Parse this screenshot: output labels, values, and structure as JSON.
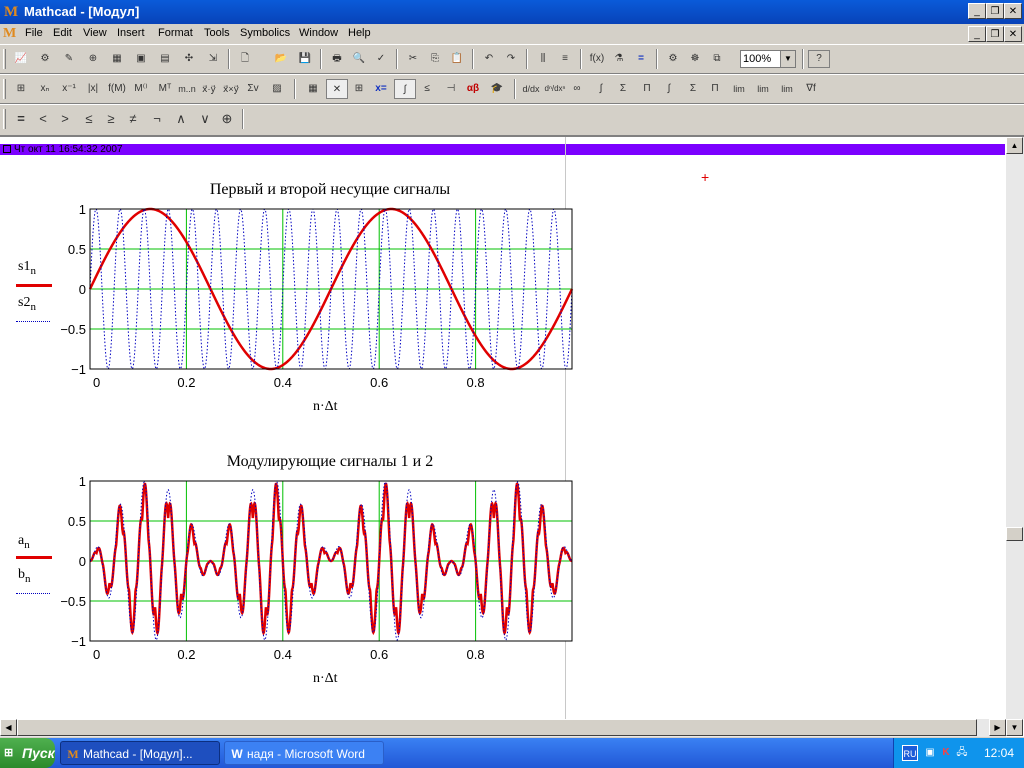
{
  "window": {
    "title": "Mathcad - [Модул]"
  },
  "menubar": {
    "items": [
      "File",
      "Edit",
      "View",
      "Insert",
      "Format",
      "Tools",
      "Symbolics",
      "Window",
      "Help"
    ]
  },
  "toolbar": {
    "zoom": "100%"
  },
  "math_toolbar": {
    "items": [
      "xₙ",
      "x⁻¹",
      "|x|",
      "f(M)",
      "M⁽⁾",
      "Mᵀ",
      "m..n",
      "x⃗·y⃗",
      "x⃗×y⃗",
      "Σv"
    ]
  },
  "boolean_toolbar": {
    "items": [
      "=",
      "<",
      ">",
      "≤",
      "≥",
      "≠",
      "¬",
      "∧",
      "∨",
      "⊕"
    ]
  },
  "calculus_toolbar": {
    "items": [
      "d/dx",
      "dⁿ/dxⁿ",
      "∞",
      "∫",
      "Σ",
      "Π",
      "∫",
      "Σ",
      "Π",
      "lim",
      "lim",
      "lim",
      "∇f"
    ]
  },
  "region_header": {
    "text": "Чт окт 11 16:54:32 2007"
  },
  "charts": [
    {
      "title": "Первый и второй несущие сигналы",
      "xlabel": "n·Δt",
      "legend": [
        {
          "base": "s1",
          "sub": "n"
        },
        {
          "base": "s2",
          "sub": "n"
        }
      ],
      "yticks": [
        "1",
        "0.5",
        "0",
        "−0.5",
        "−1"
      ],
      "xticks": [
        "0",
        "0.2",
        "0.4",
        "0.6",
        "0.8"
      ]
    },
    {
      "title": "Модулирующие сигналы 1 и 2",
      "xlabel": "n·Δt",
      "legend": [
        {
          "base": "a",
          "sub": "n"
        },
        {
          "base": "b",
          "sub": "n"
        }
      ],
      "yticks": [
        "1",
        "0.5",
        "0",
        "−0.5",
        "−1"
      ],
      "xticks": [
        "0",
        "0.2",
        "0.4",
        "0.6",
        "0.8"
      ]
    }
  ],
  "chart_data": [
    {
      "type": "line",
      "title": "Первый и второй несущие сигналы",
      "xlabel": "n·Δt",
      "xlim": [
        0,
        1
      ],
      "ylim": [
        -1,
        1
      ],
      "grid": true,
      "legend": "left",
      "series": [
        {
          "name": "s1n",
          "style": "solid",
          "color": "#e00000",
          "function": "sin(2π·2·t)"
        },
        {
          "name": "s2n",
          "style": "dotted",
          "color": "#0000c0",
          "function": "sin(2π·20·t)"
        }
      ]
    },
    {
      "type": "line",
      "title": "Модулирующие сигналы 1 и 2",
      "xlabel": "n·Δt",
      "xlim": [
        0,
        1
      ],
      "ylim": [
        -1,
        1
      ],
      "grid": true,
      "legend": "left",
      "series": [
        {
          "name": "an",
          "style": "solid",
          "color": "#e00000",
          "function": "sin(2π·2·t)·sin(2π·20·t)"
        },
        {
          "name": "bn",
          "style": "dotted",
          "color": "#0000c0",
          "function": "sin(2π·2·t)·sin(2π·20·t)"
        }
      ]
    }
  ],
  "taskbar": {
    "start": "Пуск",
    "tasks": [
      "Mathcad - [Модул]...",
      "надя - Microsoft Word"
    ],
    "tray": {
      "lang": "RU",
      "clock": "12:04"
    }
  },
  "colors": {
    "header_bar": "#7b00ff",
    "grid": "#00c000",
    "series1": "#e00000",
    "series2": "#0000c0"
  }
}
